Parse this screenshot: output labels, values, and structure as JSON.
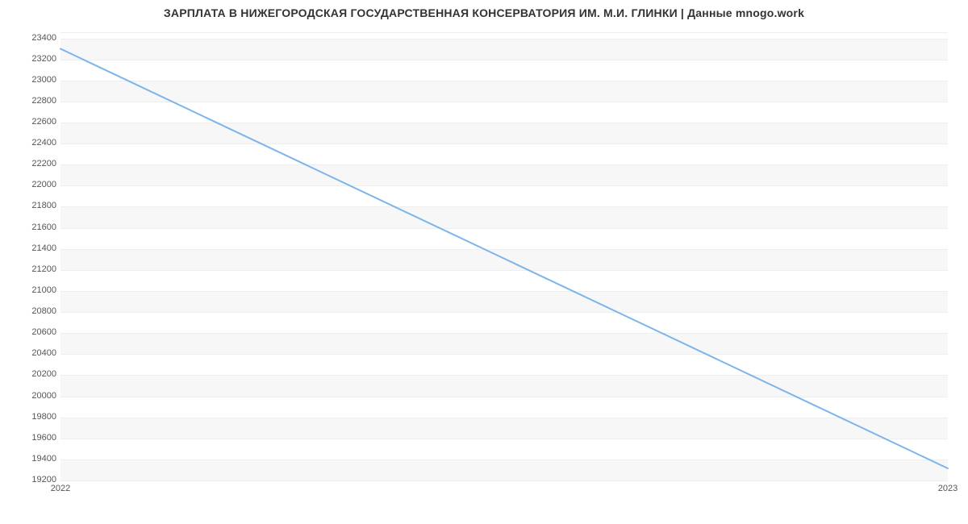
{
  "chart_data": {
    "type": "line",
    "title": "ЗАРПЛАТА В НИЖЕГОРОДСКАЯ ГОСУДАРСТВЕННАЯ КОНСЕРВАТОРИЯ ИМ. М.И. ГЛИНКИ | Данные mnogo.work",
    "xlabel": "",
    "ylabel": "",
    "x": [
      "2022",
      "2023"
    ],
    "values": [
      23300,
      19300
    ],
    "x_ticks": [
      "2022",
      "2023"
    ],
    "y_ticks": [
      19200,
      19400,
      19600,
      19800,
      20000,
      20200,
      20400,
      20600,
      20800,
      21000,
      21200,
      21400,
      21600,
      21800,
      22000,
      22200,
      22400,
      22600,
      22800,
      23000,
      23200,
      23400
    ],
    "ylim": [
      19200,
      23450
    ],
    "xlim": [
      "2022",
      "2023"
    ],
    "grid": true,
    "legend": false,
    "line_color": "#7cb5ec"
  }
}
